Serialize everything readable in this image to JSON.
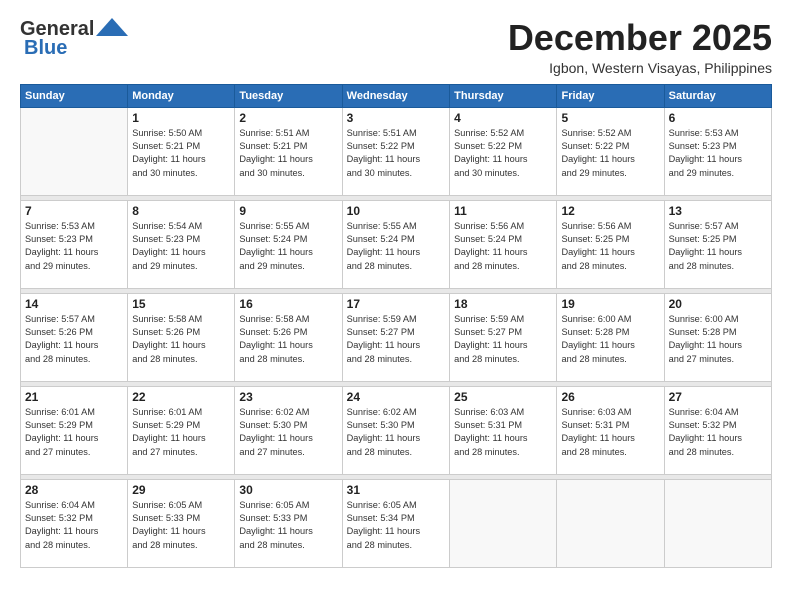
{
  "logo": {
    "line1": "General",
    "line2": "Blue"
  },
  "title": "December 2025",
  "location": "Igbon, Western Visayas, Philippines",
  "days_of_week": [
    "Sunday",
    "Monday",
    "Tuesday",
    "Wednesday",
    "Thursday",
    "Friday",
    "Saturday"
  ],
  "weeks": [
    [
      {
        "num": "",
        "info": ""
      },
      {
        "num": "1",
        "info": "Sunrise: 5:50 AM\nSunset: 5:21 PM\nDaylight: 11 hours\nand 30 minutes."
      },
      {
        "num": "2",
        "info": "Sunrise: 5:51 AM\nSunset: 5:21 PM\nDaylight: 11 hours\nand 30 minutes."
      },
      {
        "num": "3",
        "info": "Sunrise: 5:51 AM\nSunset: 5:22 PM\nDaylight: 11 hours\nand 30 minutes."
      },
      {
        "num": "4",
        "info": "Sunrise: 5:52 AM\nSunset: 5:22 PM\nDaylight: 11 hours\nand 30 minutes."
      },
      {
        "num": "5",
        "info": "Sunrise: 5:52 AM\nSunset: 5:22 PM\nDaylight: 11 hours\nand 29 minutes."
      },
      {
        "num": "6",
        "info": "Sunrise: 5:53 AM\nSunset: 5:23 PM\nDaylight: 11 hours\nand 29 minutes."
      }
    ],
    [
      {
        "num": "7",
        "info": "Sunrise: 5:53 AM\nSunset: 5:23 PM\nDaylight: 11 hours\nand 29 minutes."
      },
      {
        "num": "8",
        "info": "Sunrise: 5:54 AM\nSunset: 5:23 PM\nDaylight: 11 hours\nand 29 minutes."
      },
      {
        "num": "9",
        "info": "Sunrise: 5:55 AM\nSunset: 5:24 PM\nDaylight: 11 hours\nand 29 minutes."
      },
      {
        "num": "10",
        "info": "Sunrise: 5:55 AM\nSunset: 5:24 PM\nDaylight: 11 hours\nand 28 minutes."
      },
      {
        "num": "11",
        "info": "Sunrise: 5:56 AM\nSunset: 5:24 PM\nDaylight: 11 hours\nand 28 minutes."
      },
      {
        "num": "12",
        "info": "Sunrise: 5:56 AM\nSunset: 5:25 PM\nDaylight: 11 hours\nand 28 minutes."
      },
      {
        "num": "13",
        "info": "Sunrise: 5:57 AM\nSunset: 5:25 PM\nDaylight: 11 hours\nand 28 minutes."
      }
    ],
    [
      {
        "num": "14",
        "info": "Sunrise: 5:57 AM\nSunset: 5:26 PM\nDaylight: 11 hours\nand 28 minutes."
      },
      {
        "num": "15",
        "info": "Sunrise: 5:58 AM\nSunset: 5:26 PM\nDaylight: 11 hours\nand 28 minutes."
      },
      {
        "num": "16",
        "info": "Sunrise: 5:58 AM\nSunset: 5:26 PM\nDaylight: 11 hours\nand 28 minutes."
      },
      {
        "num": "17",
        "info": "Sunrise: 5:59 AM\nSunset: 5:27 PM\nDaylight: 11 hours\nand 28 minutes."
      },
      {
        "num": "18",
        "info": "Sunrise: 5:59 AM\nSunset: 5:27 PM\nDaylight: 11 hours\nand 28 minutes."
      },
      {
        "num": "19",
        "info": "Sunrise: 6:00 AM\nSunset: 5:28 PM\nDaylight: 11 hours\nand 28 minutes."
      },
      {
        "num": "20",
        "info": "Sunrise: 6:00 AM\nSunset: 5:28 PM\nDaylight: 11 hours\nand 27 minutes."
      }
    ],
    [
      {
        "num": "21",
        "info": "Sunrise: 6:01 AM\nSunset: 5:29 PM\nDaylight: 11 hours\nand 27 minutes."
      },
      {
        "num": "22",
        "info": "Sunrise: 6:01 AM\nSunset: 5:29 PM\nDaylight: 11 hours\nand 27 minutes."
      },
      {
        "num": "23",
        "info": "Sunrise: 6:02 AM\nSunset: 5:30 PM\nDaylight: 11 hours\nand 27 minutes."
      },
      {
        "num": "24",
        "info": "Sunrise: 6:02 AM\nSunset: 5:30 PM\nDaylight: 11 hours\nand 28 minutes."
      },
      {
        "num": "25",
        "info": "Sunrise: 6:03 AM\nSunset: 5:31 PM\nDaylight: 11 hours\nand 28 minutes."
      },
      {
        "num": "26",
        "info": "Sunrise: 6:03 AM\nSunset: 5:31 PM\nDaylight: 11 hours\nand 28 minutes."
      },
      {
        "num": "27",
        "info": "Sunrise: 6:04 AM\nSunset: 5:32 PM\nDaylight: 11 hours\nand 28 minutes."
      }
    ],
    [
      {
        "num": "28",
        "info": "Sunrise: 6:04 AM\nSunset: 5:32 PM\nDaylight: 11 hours\nand 28 minutes."
      },
      {
        "num": "29",
        "info": "Sunrise: 6:05 AM\nSunset: 5:33 PM\nDaylight: 11 hours\nand 28 minutes."
      },
      {
        "num": "30",
        "info": "Sunrise: 6:05 AM\nSunset: 5:33 PM\nDaylight: 11 hours\nand 28 minutes."
      },
      {
        "num": "31",
        "info": "Sunrise: 6:05 AM\nSunset: 5:34 PM\nDaylight: 11 hours\nand 28 minutes."
      },
      {
        "num": "",
        "info": ""
      },
      {
        "num": "",
        "info": ""
      },
      {
        "num": "",
        "info": ""
      }
    ]
  ]
}
